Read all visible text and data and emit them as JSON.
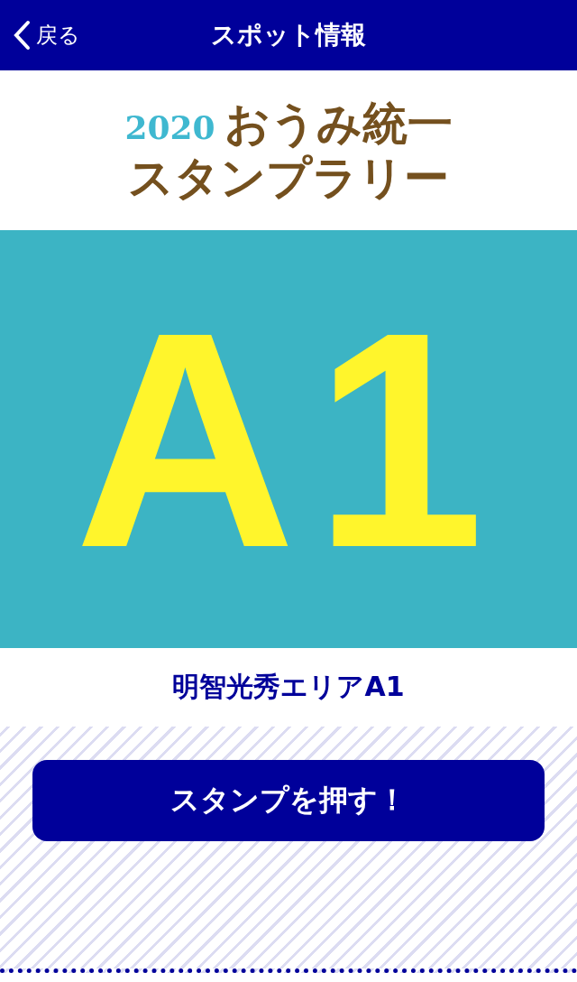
{
  "header": {
    "back_label": "戻る",
    "title": "スポット情報"
  },
  "logo": {
    "year": "2020",
    "line_1": "おうみ統一",
    "line_2": "スタンプラリー"
  },
  "spot_image": {
    "label": "A1"
  },
  "spot_name": "明智光秀エリアA1",
  "stamp_button": "スタンプを押す！"
}
